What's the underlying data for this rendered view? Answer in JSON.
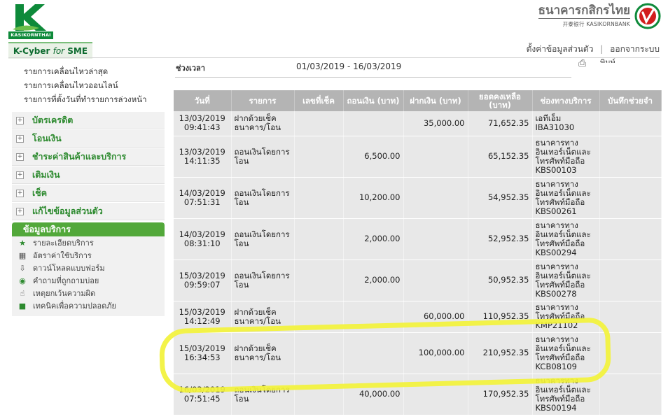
{
  "header": {
    "logo_text": "KASIKORNTHAI",
    "bank_name_th": "ธนาคารกสิกรไทย",
    "bank_name_en": "开泰银行 KASIKORNBANK",
    "product_tab": {
      "prefix": "K-Cyber ",
      "italic": "for",
      "suffix": " SME"
    },
    "links": [
      {
        "label": "ตั้งค่าข้อมูลส่วนตัว"
      },
      {
        "label": "ออกจากระบบ"
      }
    ],
    "separator": "|"
  },
  "sidebar": {
    "links": [
      {
        "label": "รายการเคลื่อนไหวล่าสุด"
      },
      {
        "label": "รายการเคลื่อนไหวออนไลน์"
      },
      {
        "label": "รายการที่ตั้งวันที่ทำรายการล่วงหน้า"
      }
    ],
    "menu": [
      {
        "label": "บัตรเครดิต"
      },
      {
        "label": "โอนเงิน"
      },
      {
        "label": "ชำระค่าสินค้าและบริการ"
      },
      {
        "label": "เติมเงิน"
      },
      {
        "label": "เช็ค"
      },
      {
        "label": "แก้ไขข้อมูลส่วนตัว"
      }
    ],
    "services_title": "ข้อมูลบริการ",
    "services": [
      {
        "label": "รายละเอียดบริการ",
        "icon": "star-icon"
      },
      {
        "label": "อัตราค่าใช้บริการ",
        "icon": "calculator-icon"
      },
      {
        "label": "ดาวน์โหลดแบบฟอร์ม",
        "icon": "download-icon"
      },
      {
        "label": "คำถามที่ถูกถามบ่อย",
        "icon": "help-icon"
      },
      {
        "label": "เหตุยกเว้นความผิด",
        "icon": "hand-icon"
      },
      {
        "label": "เทคนิคเพื่อความปลอดภัย",
        "icon": "lock-icon"
      }
    ]
  },
  "main": {
    "period_label": "ช่วงเวลา",
    "period_value": "01/03/2019 - 16/03/2019",
    "print_label": "พิมพ์",
    "columns": [
      "วันที่",
      "รายการ",
      "เลขที่เช็ค",
      "ถอนเงิน (บาท)",
      "ฝากเงิน (บาท)",
      "ยอดคงเหลือ (บาท)",
      "ช่องทางบริการ",
      "บันทึกช่วยจำ"
    ],
    "rows": [
      {
        "date": "13/03/2019\n09:41:43",
        "desc": "ฝากด้วยเช็ค\nธนาคาร/โอน",
        "cheque": "",
        "withdraw": "",
        "deposit": "35,000.00",
        "balance": "71,652.35",
        "channel": "เอทีเอ็ม\nIBA31030",
        "memo": ""
      },
      {
        "date": "13/03/2019\n14:11:35",
        "desc": "ถอนเงินโดยการ\nโอน",
        "cheque": "",
        "withdraw": "6,500.00",
        "deposit": "",
        "balance": "65,152.35",
        "channel": "ธนาคารทาง\nอินเทอร์เน็ตและ\nโทรศัพท์มือถือ\nKBS00103",
        "memo": ""
      },
      {
        "date": "14/03/2019\n07:51:31",
        "desc": "ถอนเงินโดยการ\nโอน",
        "cheque": "",
        "withdraw": "10,200.00",
        "deposit": "",
        "balance": "54,952.35",
        "channel": "ธนาคารทาง\nอินเทอร์เน็ตและ\nโทรศัพท์มือถือ\nKBS00261",
        "memo": ""
      },
      {
        "date": "14/03/2019\n08:31:10",
        "desc": "ถอนเงินโดยการ\nโอน",
        "cheque": "",
        "withdraw": "2,000.00",
        "deposit": "",
        "balance": "52,952.35",
        "channel": "ธนาคารทาง\nอินเทอร์เน็ตและ\nโทรศัพท์มือถือ\nKBS00294",
        "memo": ""
      },
      {
        "date": "15/03/2019\n09:59:07",
        "desc": "ถอนเงินโดยการ\nโอน",
        "cheque": "",
        "withdraw": "2,000.00",
        "deposit": "",
        "balance": "50,952.35",
        "channel": "ธนาคารทาง\nอินเทอร์เน็ตและ\nโทรศัพท์มือถือ\nKBS00278",
        "memo": ""
      },
      {
        "date": "15/03/2019\n14:12:49",
        "desc": "ฝากด้วยเช็ค\nธนาคาร/โอน",
        "cheque": "",
        "withdraw": "",
        "deposit": "60,000.00",
        "balance": "110,952.35",
        "channel": "ธนาคารทาง\nโทรศัพท์มือถือ\nKMP21102",
        "memo": ""
      },
      {
        "date": "15/03/2019\n16:34:53",
        "desc": "ฝากด้วยเช็ค\nธนาคาร/โอน",
        "cheque": "",
        "withdraw": "",
        "deposit": "100,000.00",
        "balance": "210,952.35",
        "channel": "ธนาคารทาง\nอินเทอร์เน็ตและ\nโทรศัพท์มือถือ\nKCB08109",
        "memo": ""
      },
      {
        "date": "16/03/2019\n07:51:45",
        "desc": "ถอนเงินโดยการ\nโอน",
        "cheque": "",
        "withdraw": "40,000.00",
        "deposit": "",
        "balance": "170,952.35",
        "channel": "ธนาคารทาง\nอินเทอร์เน็ตและ\nโทรศัพท์มือถือ\nKBS00194",
        "memo": ""
      }
    ]
  },
  "colors": {
    "brand_green": "#0e8a3a",
    "menu_green": "#2d8a2f",
    "header_gray": "#b4b4b4",
    "row_gray": "#e8e8e8",
    "highlight_yellow": "#f2f23a"
  }
}
